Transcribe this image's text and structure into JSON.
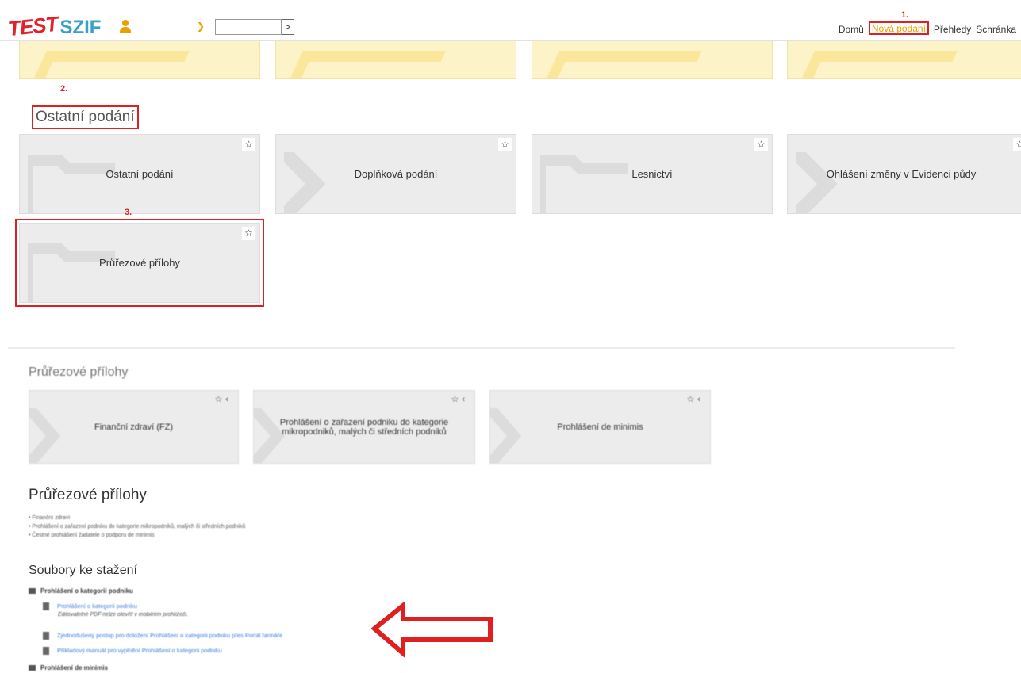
{
  "header": {
    "logo_test": "TEST",
    "logo_szif": "SZIF",
    "dropdown_icon": "chevron-down-icon",
    "go_label": ">",
    "nav": [
      "Domů",
      "Nová podání",
      "Přehledy",
      "Schránka"
    ],
    "active_nav": "Nová podání"
  },
  "annotations": {
    "n1": "1.",
    "n2": "2.",
    "n3": "3."
  },
  "section1": {
    "title": "Ostatní podání",
    "tiles": [
      "Ostatní podání",
      "Doplňková podání",
      "Lesnictví",
      "Ohlášení změny v Evidenci půdy",
      "Průřezové přílohy"
    ]
  },
  "section2": {
    "title": "Průřezové přílohy",
    "tiles": [
      "Finanční zdraví (FZ)",
      "Prohlášení o zařazení podniku do kategorie mikropodniků, malých či středních podniků",
      "Prohlášení de minimis"
    ]
  },
  "info": {
    "title": "Průřezové přílohy",
    "bullets": [
      "Finanční zdraví",
      "Prohlášení o zařazení podniku do kategorie mikropodniků, malých či středních podniků",
      "Čestné prohlášení žadatele o podporu de minimis"
    ]
  },
  "downloads": {
    "title": "Soubory ke stažení",
    "folder1": "Prohlášení o kategorii podniku",
    "files": [
      "Prohlášení o kategorii podniku",
      "Zjednodušený postup pro doložení Prohlášení o kategorii podniku přes Portál farmáře",
      "Příkladový manuál pro vyplnění Prohlášení o kategorii podniku"
    ],
    "note": "Editovatelné PDF nelze otevřít v mobilním prohlížeči.",
    "folder2": "Prohlášení de minimis"
  },
  "colors": {
    "accent": "#e8a100",
    "highlight": "#e02020",
    "link": "#3b7fd8",
    "tile": "#ececec"
  }
}
